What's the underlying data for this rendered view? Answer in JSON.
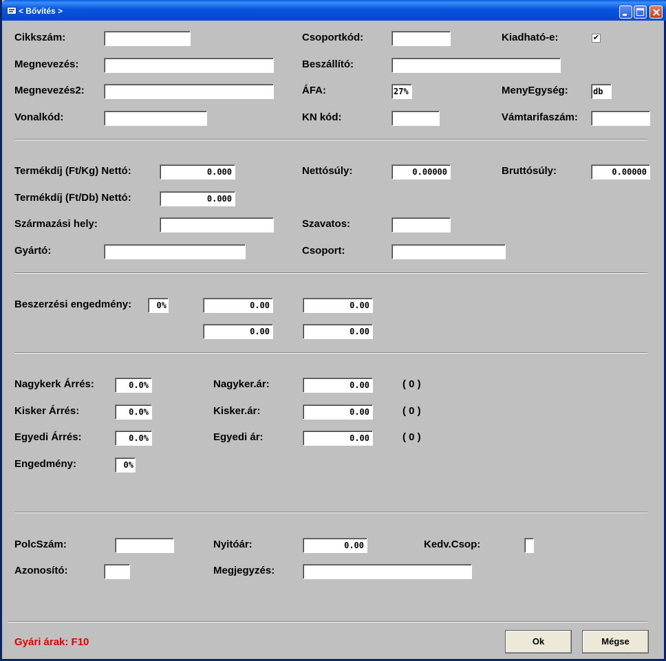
{
  "window": {
    "title": "< Bővítés >"
  },
  "header": {
    "cikkszam_label": "Cikkszám:",
    "cikkszam_value": "",
    "csoportkod_label": "Csoportkód:",
    "csoportkod_value": "",
    "kiadhato_label": "Kiadható-e:",
    "kiadhato_checked": "✔",
    "megnevezes_label": "Megnevezés:",
    "megnevezes_value": "",
    "beszallito_label": "Beszállító:",
    "beszallito_value": "",
    "megnevezes2_label": "Megnevezés2:",
    "megnevezes2_value": "",
    "afa_label": "ÁFA:",
    "afa_value": "27%",
    "menyegyseg_label": "MenyEgység:",
    "menyegyseg_value": "db",
    "vonalkod_label": "Vonalkód:",
    "vonalkod_value": "",
    "knkod_label": "KN kód:",
    "knkod_value": "",
    "vamtarifa_label": "Vámtarifaszám:",
    "vamtarifa_value": ""
  },
  "product": {
    "termekdij_kg_label": "Termékdíj (Ft/Kg) Nettó:",
    "termekdij_kg_value": "0.000",
    "nettosuly_label": "Nettósúly:",
    "nettosuly_value": "0.00000",
    "bruttosuly_label": "Bruttósúly:",
    "bruttosuly_value": "0.00000",
    "termekdij_db_label": "Termékdíj (Ft/Db) Nettó:",
    "termekdij_db_value": "0.000",
    "szarmazasi_label": "Származási hely:",
    "szarmazasi_value": "",
    "szavatos_label": "Szavatos:",
    "szavatos_value": "",
    "gyarto_label": "Gyártó:",
    "gyarto_value": "",
    "csoport_label": "Csoport:",
    "csoport_value": ""
  },
  "purchase": {
    "engedmeny_label": "Beszerzési engedmény:",
    "engedmeny_pct": "0%",
    "val1": "0.00",
    "val2": "0.00",
    "val3": "0.00",
    "val4": "0.00"
  },
  "pricing": {
    "nagyker_arres_label": "Nagykerk Árrés:",
    "nagyker_arres_value": "0.0%",
    "nagyker_ar_label": "Nagyker.ár:",
    "nagyker_ar_value": "0.00",
    "nagyker_count": "( 0 )",
    "kisker_arres_label": "Kisker Árrés:",
    "kisker_arres_value": "0.0%",
    "kisker_ar_label": "Kisker.ár:",
    "kisker_ar_value": "0.00",
    "kisker_count": "( 0 )",
    "egyedi_arres_label": "Egyedi Árrés:",
    "egyedi_arres_value": "0.0%",
    "egyedi_ar_label": "Egyedi ár:",
    "egyedi_ar_value": "0.00",
    "egyedi_count": "( 0 )",
    "engedmeny_label": "Engedmény:",
    "engedmeny_value": "0%"
  },
  "misc": {
    "polcszam_label": "PolcSzám:",
    "polcszam_value": "",
    "nyitoar_label": "Nyitóár:",
    "nyitoar_value": "0.00",
    "kedvcsop_label": "Kedv.Csop:",
    "kedvcsop_value": "",
    "azonosito_label": "Azonosító:",
    "azonosito_value": "",
    "megjegyzes_label": "Megjegyzés:",
    "megjegyzes_value": ""
  },
  "footer": {
    "hint": "Gyári árak: F10",
    "ok_label": "Ok",
    "cancel_label": "Mégse"
  }
}
